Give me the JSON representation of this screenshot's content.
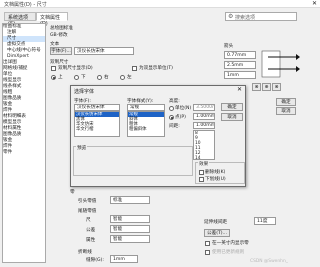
{
  "window": {
    "title": "文档属性(D) - 尺寸"
  },
  "tabs": [
    "系统选项(S)",
    "文档属性(D)"
  ],
  "search": {
    "placeholder": "搜索选项"
  },
  "tree": {
    "items": [
      "绘图标准",
      "注解",
      "尺寸",
      "虚拟交点",
      "中心线/中心符号",
      "DimXpert",
      "出详图",
      "网格线/捕捉",
      "单位",
      "线型显示",
      "线条样式",
      "线粗",
      "图像品质",
      "钣金",
      "焊件",
      "材料明细表",
      "模型显示",
      "材料属性",
      "图像品质",
      "钣金",
      "焊件",
      "零件"
    ],
    "selected_index": 2
  },
  "main": {
    "overall_std_label": "总绘图标准",
    "overall_std_value": "GB-修改",
    "text_label": "文本",
    "font_button": "字体(F)...",
    "font_display": "汉仪长仿宋体",
    "dual_dim_label": "双制尺寸",
    "dual_dim_show": "双制尺寸显示(D)",
    "show_units": "为双显示单位(T)",
    "pos_top": "上",
    "pos_bottom": "下",
    "pos_right": "右",
    "pos_left": "左",
    "arrows_label": "箭头",
    "arrow_size1": "0.77mm",
    "arrow_size2": "2.5mm",
    "arrow_size3": "1mm",
    "ok": "确定",
    "cancel": "取消",
    "zero_label": "零",
    "leader_label": "引头零值",
    "leader_value": "标准",
    "trailing_label": "尾随零值",
    "dim_label": "尺",
    "dim_value": "智能",
    "tol_label": "公差",
    "tol_value": "智能",
    "prop_label": "属性",
    "prop_value": "智能",
    "fold_label": "折断线",
    "fold_gap_label": "缝隙(G):",
    "fold_gap_value": "1mm",
    "offset_label": "在一英寸内显示零",
    "thread_label": "使用已更新规则",
    "angle_label": "延伸线间距",
    "angle_value": "11度",
    "tol_button": "公差(T)...",
    "precision_label": "精度"
  },
  "font_dialog": {
    "title": "选择字体",
    "font_label": "字体(F):",
    "font_value": "汉仪长仿宋体",
    "fonts": [
      "汉仪长仿宋体",
      "黑体",
      "华文仿宋",
      "华文行楷"
    ],
    "style_label": "字体样式(Y):",
    "style_value": "常规",
    "styles": [
      "常规",
      "斜体",
      "粗体",
      "粗偏斜体"
    ],
    "height_label": "高度:",
    "units_label": "单位(N)",
    "units_value": "3.5000mm",
    "points_label": "点(P)",
    "points_value": "1.00mm",
    "spacing_label": "间距:",
    "spacing_value": "1.00mm",
    "sizes": [
      "8",
      "9",
      "10",
      "11",
      "12",
      "14",
      "16"
    ],
    "ok": "确定",
    "cancel": "取消",
    "preview_label": "预览",
    "effects_label": "效果",
    "strike": "删除线(K)",
    "underline": "下划线(U)"
  },
  "watermark": "CSDN @Swenhn_"
}
